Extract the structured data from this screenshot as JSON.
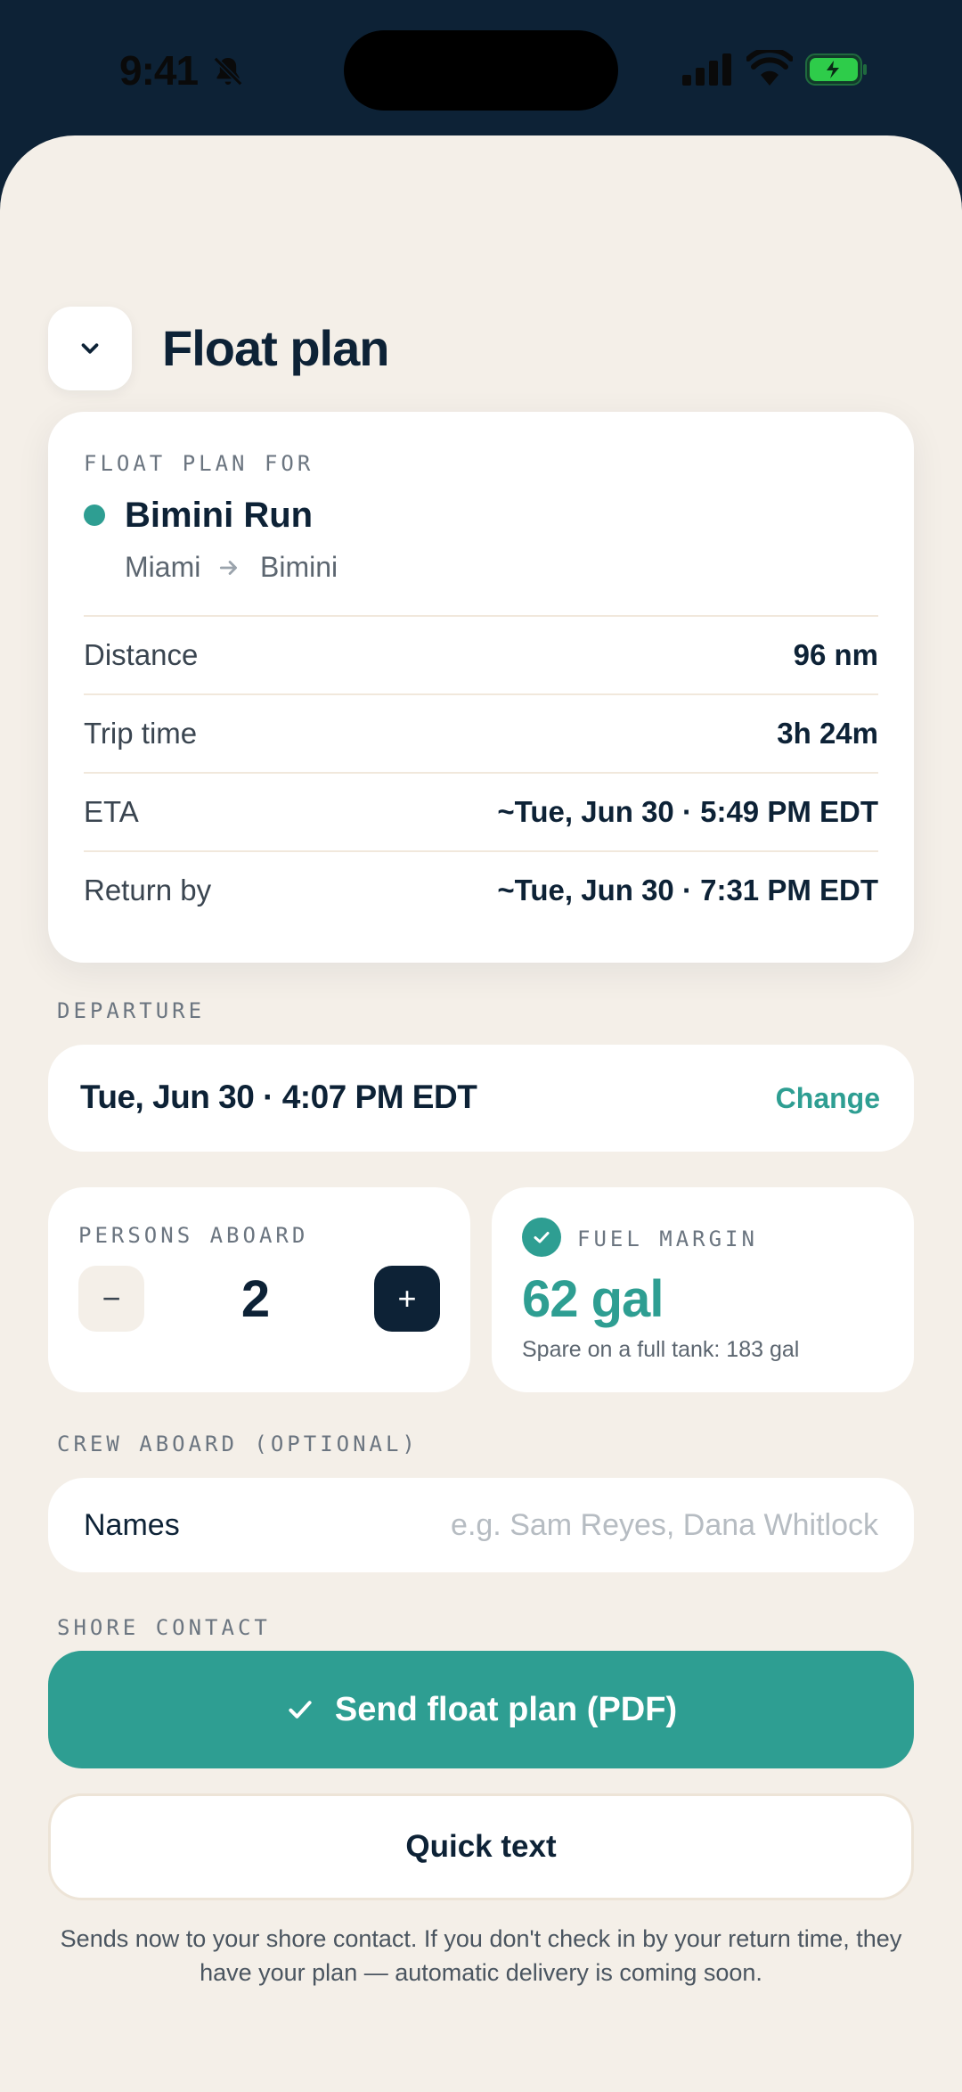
{
  "status_bar": {
    "time": "9:41",
    "icons": [
      "bell-slash-icon",
      "cellular-signal-icon",
      "wifi-icon",
      "battery-icon"
    ],
    "battery_color": "#2ecc4a"
  },
  "header": {
    "title": "Float plan",
    "collapse_icon": "chevron-down-icon"
  },
  "summary": {
    "eyebrow": "FLOAT PLAN FOR",
    "route_name": "Bimini Run",
    "from": "Miami",
    "to": "Bimini",
    "rows": [
      {
        "label": "Distance",
        "value": "96 nm"
      },
      {
        "label": "Trip time",
        "value": "3h 24m"
      },
      {
        "label": "ETA",
        "value": "~Tue, Jun 30 · 5:49 PM EDT"
      },
      {
        "label": "Return by",
        "value": "~Tue, Jun 30 · 7:31 PM EDT"
      }
    ]
  },
  "departure": {
    "section_label": "DEPARTURE",
    "value": "Tue, Jun 30 · 4:07 PM EDT",
    "change_label": "Change"
  },
  "persons": {
    "label": "PERSONS ABOARD",
    "count": "2",
    "minus": "−",
    "plus": "+"
  },
  "fuel": {
    "label": "FUEL MARGIN",
    "value": "62 gal",
    "subtext": "Spare on a full tank: 183 gal"
  },
  "crew": {
    "section_label": "CREW ABOARD (OPTIONAL)",
    "field_label": "Names",
    "value": "",
    "placeholder": "e.g. Sam Reyes, Dana Whitlock"
  },
  "shore_contact": {
    "section_label": "SHORE CONTACT"
  },
  "actions": {
    "send_label": "Send float plan (PDF)",
    "quick_label": "Quick text",
    "footnote": "Sends now to your shore contact. If you don't check in by your return time, they have your plan — automatic delivery is coming soon."
  },
  "colors": {
    "navy": "#0d2236",
    "teal": "#2e9e92",
    "sheet_background": "#f4efe8"
  }
}
